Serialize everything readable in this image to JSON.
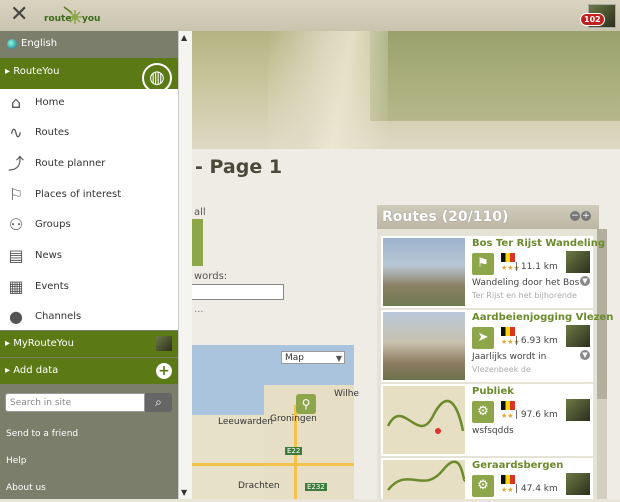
{
  "topbar": {
    "close_glyph": "✕",
    "logo_left": "route",
    "logo_right": "you",
    "notification_count": "102"
  },
  "page": {
    "title_fragment": "- Page 1",
    "frag_all": "all",
    "frag_words": "words:",
    "frag_dots": "..."
  },
  "map": {
    "type_select": "Map",
    "labels": [
      "Groningen",
      "Leeuwarden",
      "Wilhe",
      "Drachten"
    ],
    "road_signs": [
      "E22",
      "E232"
    ]
  },
  "sidebar": {
    "language": "English",
    "section_title": "RouteYou",
    "menu": [
      {
        "label": "Home",
        "icon": "home-icon"
      },
      {
        "label": "Routes",
        "icon": "routes-icon"
      },
      {
        "label": "Route planner",
        "icon": "route-planner-icon"
      },
      {
        "label": "Places of interest",
        "icon": "flag-icon"
      },
      {
        "label": "Groups",
        "icon": "groups-icon"
      },
      {
        "label": "News",
        "icon": "news-icon"
      },
      {
        "label": "Events",
        "icon": "calendar-icon"
      },
      {
        "label": "Channels",
        "icon": "user-icon"
      }
    ],
    "my_routeyou": "MyRouteYou",
    "add_data": "Add data",
    "search_placeholder": "Search in site",
    "links": [
      "Send to a friend",
      "Help",
      "About us"
    ]
  },
  "routes": {
    "title": "Routes (20/110)",
    "items": [
      {
        "name": "Bos Ter Rijst Wandeling",
        "distance": "| 11.1 km",
        "desc": "Wandeling door het Bos",
        "desc2": "Ter Rijst en het bijhorende",
        "activity": "hiking-icon"
      },
      {
        "name": "Aardbeienjogging Vlezen",
        "distance": "| 6.93 km",
        "desc": "Jaarlijks wordt in",
        "desc2": "Vlezenbeek de",
        "activity": "running-icon"
      },
      {
        "name": "Publiek",
        "distance": "| 97.6 km",
        "desc": "wsfsqdds",
        "desc2": "",
        "activity": "cycling-icon"
      },
      {
        "name": "Geraardsbergen",
        "distance": "| 47.4 km",
        "desc": "",
        "desc2": "",
        "activity": "cycling-icon"
      }
    ]
  },
  "colors": {
    "brand_green": "#5b7a16",
    "accent_green": "#8ea64a",
    "badge_red": "#c0211e"
  }
}
